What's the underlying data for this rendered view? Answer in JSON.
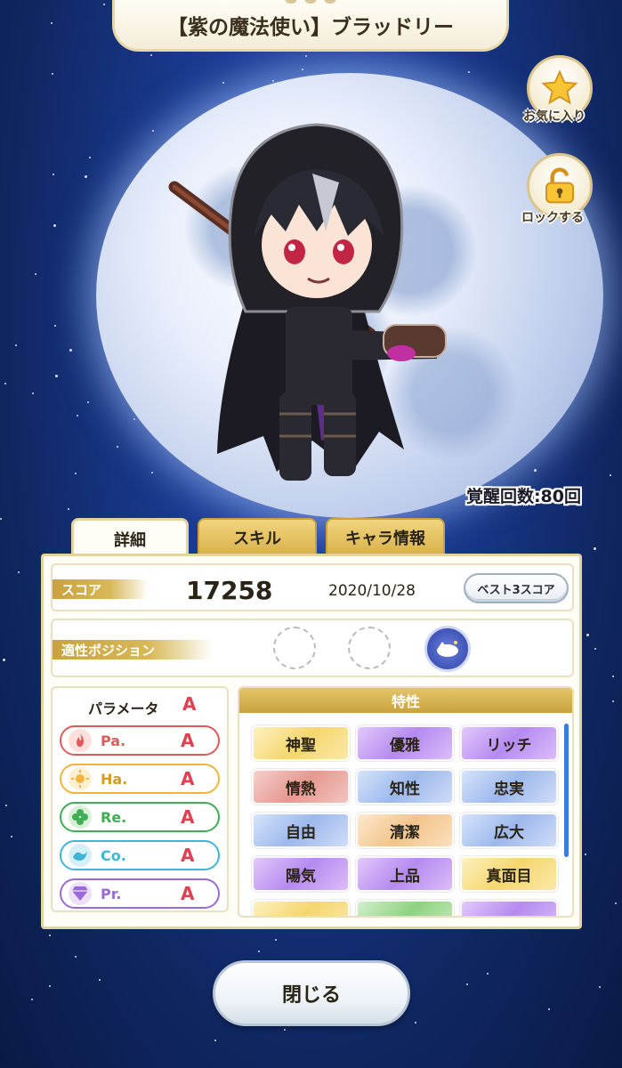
{
  "title": "【紫の魔法使い】ブラッドリー",
  "side_buttons": {
    "favorite_label": "お気に入り",
    "favorite_icon": "star-icon",
    "lock_label": "ロックする",
    "lock_icon": "lock-icon"
  },
  "awakening": "覚醒回数:80回",
  "tabs": [
    {
      "label": "詳細",
      "active": true
    },
    {
      "label": "スキル",
      "active": false
    },
    {
      "label": "キャラ情報",
      "active": false
    }
  ],
  "score": {
    "label": "スコア",
    "value": "17258",
    "date": "2020/10/28",
    "best_button": "ベスト3スコア"
  },
  "positions": {
    "label": "適性ポジション",
    "slots": [
      "empty",
      "empty",
      "filled"
    ]
  },
  "parameters": {
    "title": "パラメータ",
    "overall_grade": "A",
    "items": [
      {
        "name": "Pa.",
        "grade": "A",
        "color": "#e05a5a",
        "icon": "flame-icon"
      },
      {
        "name": "Ha.",
        "grade": "A",
        "color": "#f2b43a",
        "icon": "sun-icon"
      },
      {
        "name": "Re.",
        "grade": "A",
        "color": "#3fae54",
        "icon": "clover-icon"
      },
      {
        "name": "Co.",
        "grade": "A",
        "color": "#3fb6d8",
        "icon": "wave-icon"
      },
      {
        "name": "Pr.",
        "grade": "A",
        "color": "#9a6ad8",
        "icon": "diamond-icon"
      }
    ]
  },
  "traits": {
    "title": "特性",
    "items": [
      {
        "label": "神聖",
        "color": "gold"
      },
      {
        "label": "優雅",
        "color": "purple"
      },
      {
        "label": "リッチ",
        "color": "purple"
      },
      {
        "label": "情熱",
        "color": "red"
      },
      {
        "label": "知性",
        "color": "blue"
      },
      {
        "label": "忠実",
        "color": "blue"
      },
      {
        "label": "自由",
        "color": "blue"
      },
      {
        "label": "清潔",
        "color": "orange"
      },
      {
        "label": "広大",
        "color": "blue"
      },
      {
        "label": "陽気",
        "color": "purple"
      },
      {
        "label": "上品",
        "color": "purple"
      },
      {
        "label": "真面目",
        "color": "gold"
      },
      {
        "label": "",
        "color": "gold"
      },
      {
        "label": "",
        "color": "green"
      },
      {
        "label": "",
        "color": "purple"
      }
    ]
  },
  "close_button": "閉じる"
}
